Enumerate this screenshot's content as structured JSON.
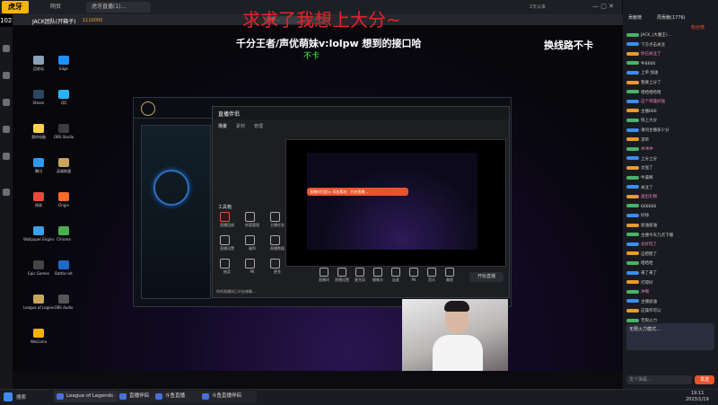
{
  "outer_tabs": {
    "logo": "虎牙",
    "active_tab": "虎牙直播(1)…",
    "tab2": "League of Legends",
    "tab3": "网页",
    "room_number": "1022…",
    "status_text": "2天以来",
    "search_placeholder": "搜索…"
  },
  "stream": {
    "caption_red": "求求了我想上大分~",
    "caption_white": "千分王者/声优萌妹v:lolpw  想到的接口哈",
    "caption_green": "不卡",
    "caption_route": "换线路不卡",
    "streamer_name": "JACK团队(开箱子)",
    "score_text": "1110000"
  },
  "desktop_icons": [
    {
      "label": "回收站"
    },
    {
      "label": "Steam"
    },
    {
      "label": "我的电脑"
    },
    {
      "label": "腾讯"
    },
    {
      "label": "网易"
    },
    {
      "label": "Wallpaper Engine"
    },
    {
      "label": "Epic Games"
    },
    {
      "label": "League of Legends"
    },
    {
      "label": "WeGame"
    },
    {
      "label": "Edge"
    },
    {
      "label": "QQ"
    },
    {
      "label": "OBS Studio"
    },
    {
      "label": "英雄联盟"
    },
    {
      "label": "Origin"
    },
    {
      "label": "Chrome"
    },
    {
      "label": "Battle.net"
    },
    {
      "label": "OBS Audio"
    }
  ],
  "app": {
    "title": "直播伴侣",
    "tab_scene": "场景",
    "tab_source": "素材",
    "tab_manage": "管理",
    "start_button": "开始直播",
    "tools_label": "工具箱",
    "notice": "你的直播间已开启弹幕…",
    "orange_overlay": "直播伴侣提示 添加素材：开启直播…",
    "tools": [
      {
        "label": "直播回放"
      },
      {
        "label": "房管管理"
      },
      {
        "label": "主播任务"
      },
      {
        "label": "直播设置"
      },
      {
        "label": "福利"
      },
      {
        "label": "直播数据"
      },
      {
        "label": "抽奖"
      },
      {
        "label": "PK"
      },
      {
        "label": "更多"
      }
    ],
    "bottom_tools": [
      {
        "label": "直播间"
      },
      {
        "label": "直播设置"
      },
      {
        "label": "麦克风"
      },
      {
        "label": "摄像头"
      },
      {
        "label": "连麦"
      },
      {
        "label": "PK"
      },
      {
        "label": "音乐"
      },
      {
        "label": "美颜"
      }
    ]
  },
  "right_panel": {
    "tab_ranking": "贡献榜",
    "tab_weekly": "周贡献(1776)",
    "tab_fans": "粉丝榜",
    "tab_gift": "礼物",
    "chat": [
      {
        "text": "JACK_(大魔王)…"
      },
      {
        "text": "下方点击关注"
      },
      {
        "text": "你已关注了"
      },
      {
        "text": "牛B666"
      },
      {
        "text": "上单 加油"
      },
      {
        "text": "我要上分了"
      },
      {
        "text": "哈哈哈哈哈"
      },
      {
        "text": "这个英雄好强"
      },
      {
        "text": "主播666"
      },
      {
        "text": "快上大分"
      },
      {
        "text": "请问主播多少分"
      },
      {
        "text": "求带"
      },
      {
        "text": "冲冲冲"
      },
      {
        "text": "上分上分"
      },
      {
        "text": "太强了"
      },
      {
        "text": "牛逼啊"
      },
      {
        "text": "关注了"
      },
      {
        "text": "送出礼物"
      },
      {
        "text": "666666"
      },
      {
        "text": "好帅"
      },
      {
        "text": "加油加油"
      },
      {
        "text": "主播今天几点下播"
      },
      {
        "text": "太好玩了"
      },
      {
        "text": "这把稳了"
      },
      {
        "text": "哈哈哈"
      },
      {
        "text": "来了来了"
      },
      {
        "text": "打得好"
      },
      {
        "text": "冲啊"
      },
      {
        "text": "主播加油"
      },
      {
        "text": "这操作可以"
      },
      {
        "text": "无限火力"
      }
    ],
    "gift_banner": "无限火力模式…",
    "chat_placeholder": "发个弹幕…",
    "send_button": "发送"
  },
  "taskbar": {
    "search": "搜索",
    "items": [
      {
        "label": "League of Legends"
      },
      {
        "label": "直播伴侣"
      },
      {
        "label": "斗鱼直播"
      },
      {
        "label": "斗鱼直播伴侣"
      }
    ],
    "time": "19:11",
    "date": "2023/1/19"
  },
  "colors": {
    "accent_red": "#e8232b",
    "accent_orange": "#e8532c",
    "chat_green": "#47b36a"
  }
}
